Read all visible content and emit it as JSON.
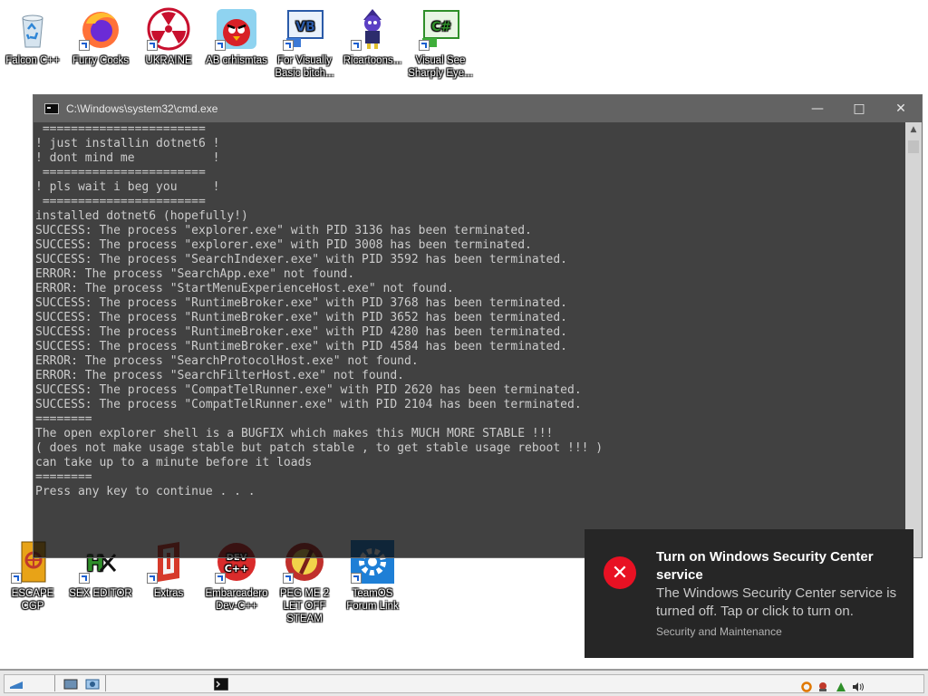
{
  "desktop": {
    "icons": [
      {
        "label": "Falcon C++",
        "icon": "recycle-bin-icon"
      },
      {
        "label": "Furry Cocks",
        "icon": "firefox-icon"
      },
      {
        "label": "UKRAINE",
        "icon": "radiation-icon"
      },
      {
        "label": "AB crhismtas",
        "icon": "angry-bird-icon"
      },
      {
        "label": "For Visually Basic bitch...",
        "icon": "visual-basic-icon"
      },
      {
        "label": "Ricartoons...",
        "icon": "cartoon-character-icon"
      },
      {
        "label": "Visual See Sharply Eye...",
        "icon": "csharp-icon"
      },
      {
        "label": "ESCAPE CGP",
        "icon": "escape-cgp-icon"
      },
      {
        "label": "SEX EDITOR",
        "icon": "hex-editor-icon"
      },
      {
        "label": "Extras",
        "icon": "extras-icon"
      },
      {
        "label": "Embarcadero Dev-C++",
        "icon": "dev-cpp-icon"
      },
      {
        "label": "PEG ME 2 LET OFF STEAM",
        "icon": "peg-icon"
      },
      {
        "label": "TeamOS Forum Link",
        "icon": "gear-icon"
      }
    ]
  },
  "cmd": {
    "title": "C:\\Windows\\system32\\cmd.exe",
    "lines": [
      " ======================= ",
      "! just installin dotnet6 !",
      "! dont mind me           !",
      " ======================= ",
      "! pls wait i beg you     !",
      " ======================= ",
      "installed dotnet6 (hopefully!)",
      "SUCCESS: The process \"explorer.exe\" with PID 3136 has been terminated.",
      "SUCCESS: The process \"explorer.exe\" with PID 3008 has been terminated.",
      "SUCCESS: The process \"SearchIndexer.exe\" with PID 3592 has been terminated.",
      "ERROR: The process \"SearchApp.exe\" not found.",
      "ERROR: The process \"StartMenuExperienceHost.exe\" not found.",
      "SUCCESS: The process \"RuntimeBroker.exe\" with PID 3768 has been terminated.",
      "SUCCESS: The process \"RuntimeBroker.exe\" with PID 3652 has been terminated.",
      "SUCCESS: The process \"RuntimeBroker.exe\" with PID 4280 has been terminated.",
      "SUCCESS: The process \"RuntimeBroker.exe\" with PID 4584 has been terminated.",
      "ERROR: The process \"SearchProtocolHost.exe\" not found.",
      "ERROR: The process \"SearchFilterHost.exe\" not found.",
      "SUCCESS: The process \"CompatTelRunner.exe\" with PID 2620 has been terminated.",
      "SUCCESS: The process \"CompatTelRunner.exe\" with PID 2104 has been terminated.",
      "========",
      "The open explorer shell is a BUGFIX which makes this MUCH MORE STABLE !!!",
      "( does not make usage stable but patch stable , to get stable usage reboot !!! )",
      "can take up to a minute before it loads",
      "========",
      "Press any key to continue . . ."
    ]
  },
  "toast": {
    "title": "Turn on Windows Security Center service",
    "body": "The Windows Security Center service is turned off. Tap or click to turn on.",
    "source": "Security and Maintenance",
    "icon": "error-x-icon",
    "accent": "#e81123"
  },
  "taskbar": {
    "items": [
      "start-icon",
      "show-desktop-icon",
      "explorer-icon",
      "cmd-icon"
    ],
    "tray": [
      "orange-ring-icon",
      "security-icon",
      "warning-icon",
      "volume-icon"
    ]
  }
}
